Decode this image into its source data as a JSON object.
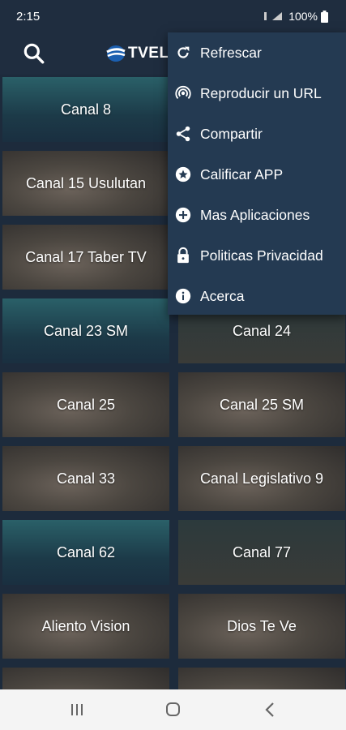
{
  "status": {
    "time": "2:15",
    "battery": "100%"
  },
  "app": {
    "logo_text": "TVELS"
  },
  "tiles": [
    {
      "label": "Canal 8"
    },
    {
      "label": "Canal 15 Usulutan"
    },
    {
      "label": "Canal 17 Taber TV"
    },
    {
      "label": "Canal 23 SM"
    },
    {
      "label": "Canal 24"
    },
    {
      "label": "Canal 25"
    },
    {
      "label": "Canal 25 SM"
    },
    {
      "label": "Canal 33"
    },
    {
      "label": "Canal Legislativo 9"
    },
    {
      "label": "Canal 62"
    },
    {
      "label": "Canal 77"
    },
    {
      "label": "Aliento Vision"
    },
    {
      "label": "Dios Te Ve"
    }
  ],
  "menu": [
    {
      "label": "Refrescar",
      "icon": "refresh-icon"
    },
    {
      "label": "Reproducir un URL",
      "icon": "broadcast-icon"
    },
    {
      "label": "Compartir",
      "icon": "share-icon"
    },
    {
      "label": "Calificar APP",
      "icon": "star-icon"
    },
    {
      "label": "Mas Aplicaciones",
      "icon": "add-icon"
    },
    {
      "label": "Politicas Privacidad",
      "icon": "lock-icon"
    },
    {
      "label": "Acerca",
      "icon": "info-icon"
    }
  ]
}
